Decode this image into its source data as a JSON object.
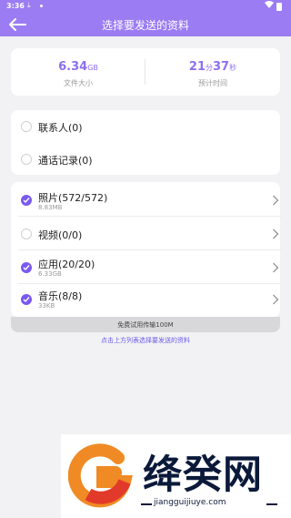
{
  "status_bar": {
    "time": "3:36",
    "download_glyph": "⤓"
  },
  "nav": {
    "title": "选择要发送的资料"
  },
  "summary": {
    "size_value": "6.34",
    "size_unit": "GB",
    "size_label": "文件大小",
    "time_min": "21",
    "time_min_unit": "分",
    "time_sec": "37",
    "time_sec_unit": "秒",
    "time_label": "预计时间"
  },
  "contacts_group": [
    {
      "label": "联系人(0)",
      "checked": false
    },
    {
      "label": "通话记录(0)",
      "checked": false
    }
  ],
  "media_group": [
    {
      "label": "照片(572/572)",
      "size": "8.83MB",
      "checked": true
    },
    {
      "label": "视频(0/0)",
      "size": "",
      "checked": false
    },
    {
      "label": "应用(20/20)",
      "size": "6.33GB",
      "checked": true
    },
    {
      "label": "音乐(8/8)",
      "size": "33KB",
      "checked": true
    }
  ],
  "trial_banner": "免费试用传输100M",
  "hint": "点击上方列表选择要发送的资料",
  "watermark": {
    "name": "绛癸网",
    "url": "jiangguijiuye.com"
  },
  "colors": {
    "accent": "#9b7cf2",
    "check": "#7a5af0",
    "value": "#8d6ff0"
  }
}
